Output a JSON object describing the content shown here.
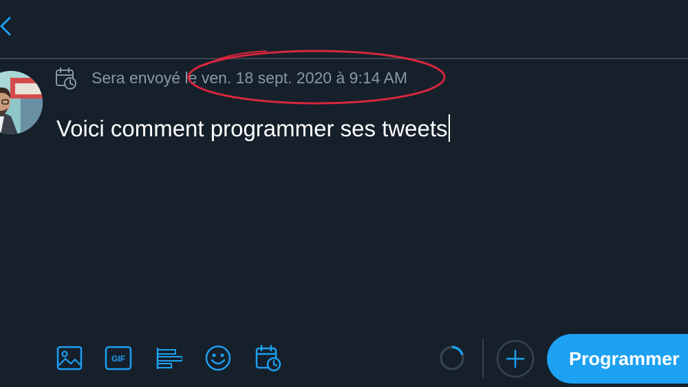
{
  "header": {
    "back_icon": "chevron-left-icon"
  },
  "composer": {
    "schedule_icon": "calendar-clock-icon",
    "schedule_prefix": "Sera envoyé",
    "schedule_date": " le ven. 18 sept. 2020 à 9:14 AM",
    "tweet_text": "Voici comment programmer ses tweets"
  },
  "annotation": {
    "shape": "ellipse",
    "color": "#d7263d"
  },
  "toolbar": {
    "tools": [
      "image-icon",
      "gif-icon",
      "poll-icon",
      "emoji-icon",
      "schedule-icon"
    ],
    "gif_label": "GIF",
    "submit_label": "Programmer"
  },
  "colors": {
    "background": "#15202b",
    "accent": "#1da1f2",
    "muted_text": "#8899a6",
    "divider": "#38444d",
    "text": "#ffffff"
  }
}
